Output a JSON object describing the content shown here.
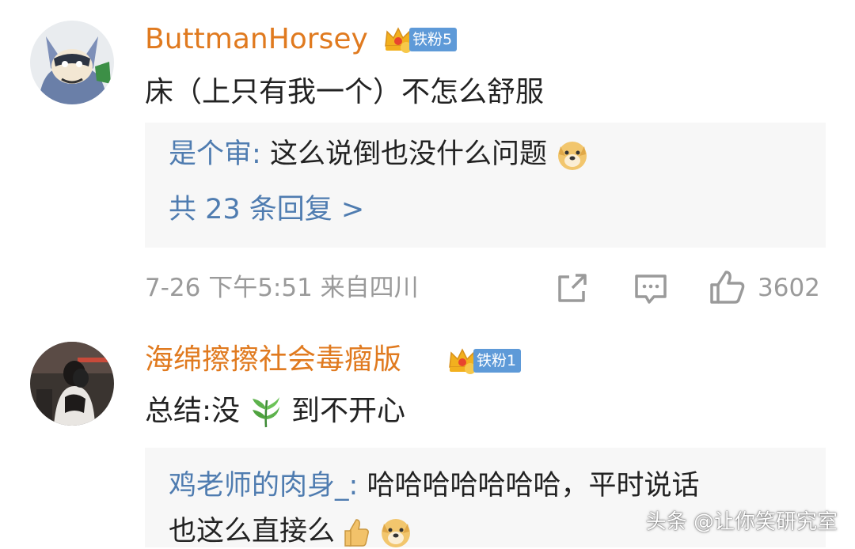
{
  "comments": [
    {
      "username": "ButtmanHorsey",
      "fan_badge": "铁粉5",
      "text": "床（上只有我一个）不怎么舒服",
      "reply": {
        "author": "是个审",
        "separator": ": ",
        "text": "这么说倒也没什么问题"
      },
      "reply_count": "共 23 条回复 >",
      "time": "7-26  下午5:51  来自四川",
      "likes": "3602",
      "avatar_icon": "batman-cartoon-avatar"
    },
    {
      "username": "海绵擦擦社会毒瘤版",
      "fan_badge": "铁粉1",
      "text_before": "总结:没",
      "text_after": "到不开心",
      "reply": {
        "author": "鸡老师的肉身_",
        "separator": ": ",
        "text_line1": "哈哈哈哈哈哈哈，平时说话",
        "text_line2": "也这么直接么"
      },
      "avatar_icon": "couple-hug-photo-avatar"
    }
  ],
  "watermark": "头条 @让你笑研究室",
  "colors": {
    "username": "#e07a1f",
    "reply_author": "#4f7cb0",
    "fan_badge_bg": "#5e9ad8",
    "meta_gray": "#9a9a9a",
    "reply_bg": "#f7f7f7"
  }
}
